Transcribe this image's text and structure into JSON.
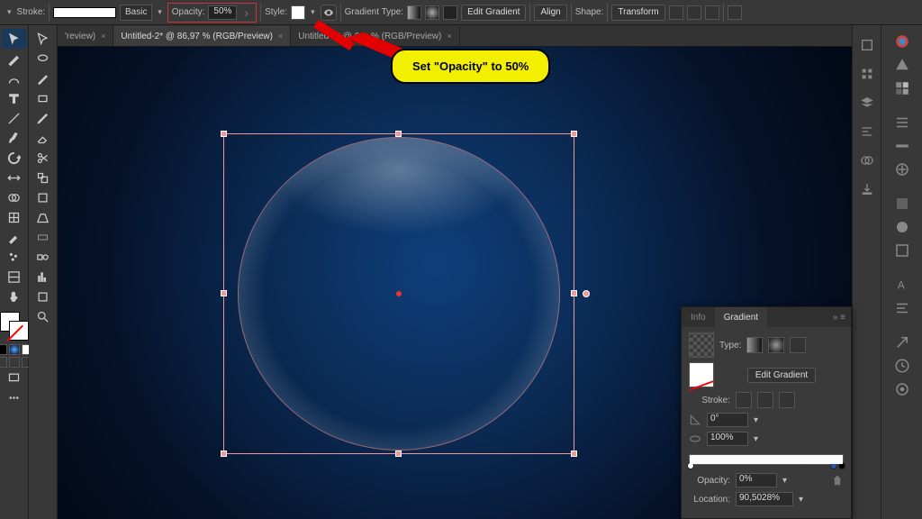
{
  "options_bar": {
    "stroke_label": "Stroke:",
    "stroke_style_name": "Basic",
    "opacity_label": "Opacity:",
    "opacity_value": "50%",
    "style_label": "Style:",
    "gradient_type_label": "Gradient Type:",
    "edit_gradient": "Edit Gradient",
    "align": "Align",
    "shape": "Shape:",
    "transform": "Transform"
  },
  "tabs": [
    {
      "label": "'review)",
      "close": "×",
      "active": false
    },
    {
      "label": "Untitled-2* @ 86,97 % (RGB/Preview)",
      "close": "×",
      "active": true
    },
    {
      "label": "Untitled-3* @ 6…  % (RGB/Preview)",
      "close": "×",
      "active": false
    }
  ],
  "annotation": {
    "text": "Set \"Opacity\" to 50%"
  },
  "gradient_panel": {
    "tab_info": "Info",
    "tab_gradient": "Gradient",
    "type_label": "Type:",
    "edit_gradient": "Edit Gradient",
    "stroke_label": "Stroke:",
    "angle_value": "0°",
    "scale_value": "100%",
    "opacity_label": "Opacity:",
    "opacity_value": "0%",
    "location_label": "Location:",
    "location_value": "90,5028%"
  },
  "colors": {
    "accent": "#c33",
    "callout": "#f2ef00"
  }
}
